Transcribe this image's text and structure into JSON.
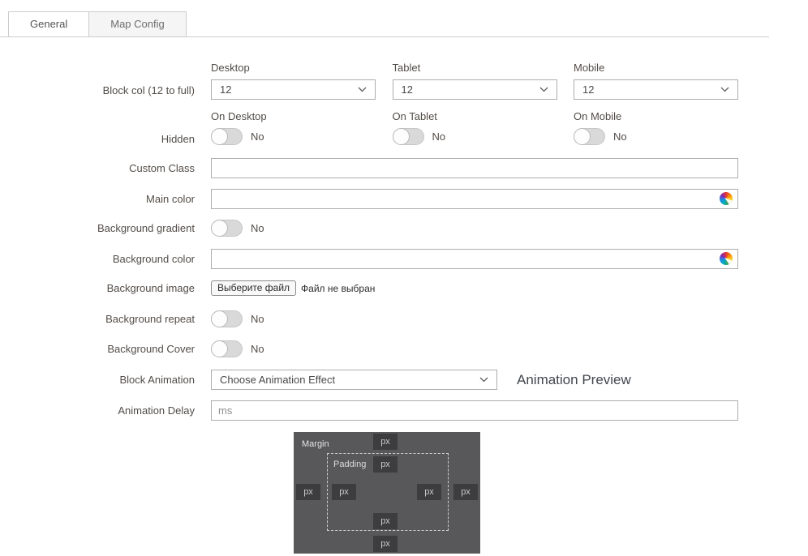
{
  "tabs": [
    {
      "label": "General"
    },
    {
      "label": "Map Config"
    }
  ],
  "form": {
    "block_col": {
      "label": "Block col (12 to full)",
      "columns": [
        {
          "header": "Desktop",
          "value": "12"
        },
        {
          "header": "Tablet",
          "value": "12"
        },
        {
          "header": "Mobile",
          "value": "12"
        }
      ]
    },
    "hidden": {
      "label": "Hidden",
      "columns": [
        {
          "header": "On Desktop",
          "state": "No"
        },
        {
          "header": "On Tablet",
          "state": "No"
        },
        {
          "header": "On Mobile",
          "state": "No"
        }
      ]
    },
    "custom_class": {
      "label": "Custom Class",
      "value": ""
    },
    "main_color": {
      "label": "Main color",
      "value": ""
    },
    "background_gradient": {
      "label": "Background gradient",
      "state": "No"
    },
    "background_color": {
      "label": "Background color",
      "value": ""
    },
    "background_image": {
      "label": "Background image",
      "button": "Выберите файл",
      "status": "Файл не выбран"
    },
    "background_repeat": {
      "label": "Background repeat",
      "state": "No"
    },
    "background_cover": {
      "label": "Background Cover",
      "state": "No"
    },
    "block_animation": {
      "label": "Block Animation",
      "value": "Choose Animation Effect",
      "preview": "Animation Preview"
    },
    "animation_delay": {
      "label": "Animation Delay",
      "placeholder": "ms"
    }
  },
  "box_model": {
    "margin_label": "Margin",
    "padding_label": "Padding",
    "unit_placeholder": "px"
  },
  "colors": {
    "input_border": "#adadad",
    "box_bg": "#58585a",
    "box_input_bg": "#3d3d3f",
    "toggle_track": "#d9d9d9"
  }
}
